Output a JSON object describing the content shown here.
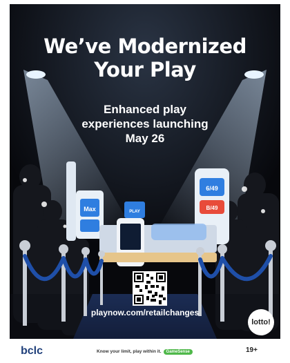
{
  "headline": {
    "line1": "We’ve Modernized",
    "line2": "Your Play"
  },
  "subheadline": {
    "line1": "Enhanced play",
    "line2": "experiences launching",
    "line3": "May 26"
  },
  "kiosk": {
    "screen_left": "Max",
    "screen_right_top": "6/49",
    "screen_right_bottom": "B/49",
    "panel": "PLAY"
  },
  "url": "playnow.com/retailchanges",
  "badge": "lotto!",
  "footer": {
    "brand": "bclc",
    "tagline": "Know your limit, play within it.",
    "gamesense": "GameSense",
    "age": "19+"
  },
  "colors": {
    "background": "#07080c",
    "rope": "#1f4fa8",
    "kiosk_blue": "#2f7ee0",
    "brand_blue": "#1f3f7a",
    "gamesense_green": "#4fb84a"
  }
}
